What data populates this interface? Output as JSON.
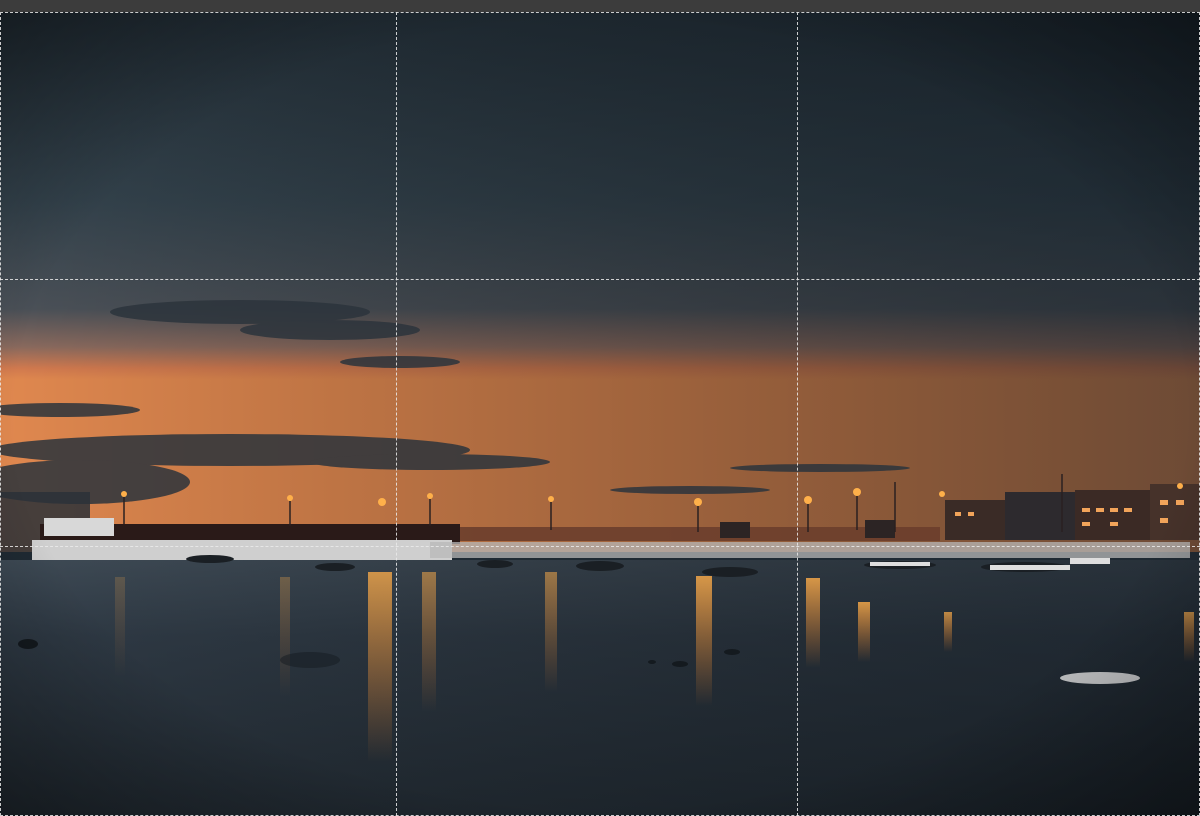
{
  "canvas": {
    "image_subject": "",
    "background_color": "#3a3a3a",
    "colors": {
      "sky_top": "#233039",
      "sky_mid": "#3b4a55",
      "horizon_glow": "#d9774a",
      "water": "#2a3540",
      "light_reflection": "#ff9a3a"
    }
  },
  "crop_tool": {
    "guide": "rule-of-thirds",
    "border_style": "dashed"
  }
}
